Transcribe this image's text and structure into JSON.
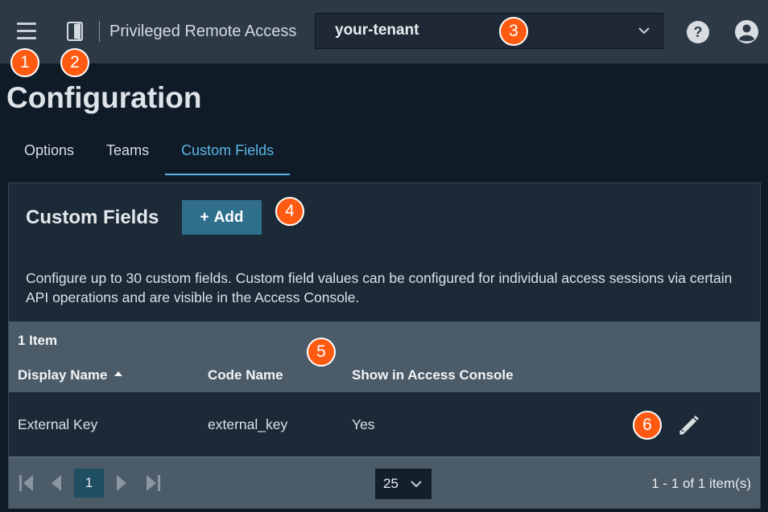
{
  "header": {
    "app_title": "Privileged Remote Access",
    "tenant": "your-tenant",
    "icons": [
      "menu-icon",
      "app-door-icon",
      "chevron-down-icon",
      "help-icon",
      "user-icon"
    ]
  },
  "page": {
    "title": "Configuration",
    "tabs": [
      {
        "label": "Options",
        "active": false
      },
      {
        "label": "Teams",
        "active": false
      },
      {
        "label": "Custom Fields",
        "active": true
      }
    ]
  },
  "panel": {
    "title": "Custom Fields",
    "add_label": "Add",
    "description": "Configure up to 30 custom fields. Custom field values can be configured for individual access sessions via certain API operations and are visible in the Access Console."
  },
  "grid": {
    "item_count": "1 Item",
    "columns": [
      "Display Name",
      "Code Name",
      "Show in Access Console"
    ],
    "sort": {
      "column": "Display Name",
      "direction": "ascending"
    },
    "rows": [
      {
        "display_name": "External Key",
        "code_name": "external_key",
        "show_in_console": "Yes"
      }
    ]
  },
  "pager": {
    "current_page": "1",
    "page_size": "25",
    "range": "1 - 1 of 1 item(s)"
  },
  "callouts": [
    "1",
    "2",
    "3",
    "4",
    "5",
    "6"
  ],
  "colors": {
    "callout": "#ff5a12",
    "accent": "#5cb6e6",
    "button": "#2f6f8c"
  }
}
